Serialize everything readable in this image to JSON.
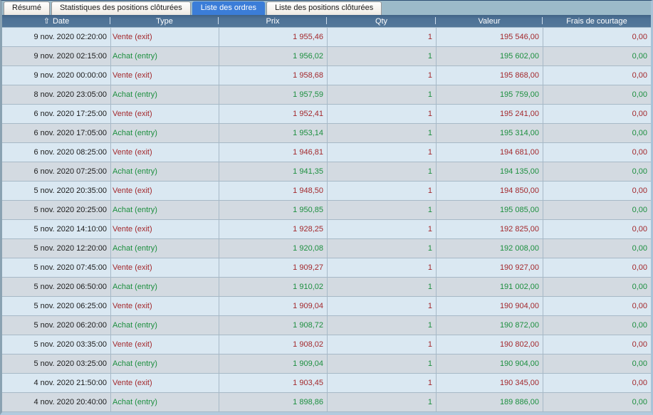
{
  "tabs": [
    {
      "id": "resume",
      "label": "Résumé",
      "active": false
    },
    {
      "id": "stats-positions",
      "label": "Statistiques des positions clôturées",
      "active": false
    },
    {
      "id": "orders-list",
      "label": "Liste des ordres",
      "active": true
    },
    {
      "id": "closed-positions",
      "label": "Liste des positions clôturées",
      "active": false
    }
  ],
  "table": {
    "sort_icon": "⇧",
    "sorted_column": "Date",
    "columns": [
      "Date",
      "Type",
      "Prix",
      "Qty",
      "Valeur",
      "Frais de courtage"
    ],
    "rows": [
      {
        "date": "9 nov. 2020 02:20:00",
        "type": "Vente (exit)",
        "prix": "1 955,46",
        "qty": "1",
        "valeur": "195 546,00",
        "frais": "0,00",
        "side": "sell"
      },
      {
        "date": "9 nov. 2020 02:15:00",
        "type": "Achat (entry)",
        "prix": "1 956,02",
        "qty": "1",
        "valeur": "195 602,00",
        "frais": "0,00",
        "side": "buy"
      },
      {
        "date": "9 nov. 2020 00:00:00",
        "type": "Vente (exit)",
        "prix": "1 958,68",
        "qty": "1",
        "valeur": "195 868,00",
        "frais": "0,00",
        "side": "sell"
      },
      {
        "date": "8 nov. 2020 23:05:00",
        "type": "Achat (entry)",
        "prix": "1 957,59",
        "qty": "1",
        "valeur": "195 759,00",
        "frais": "0,00",
        "side": "buy"
      },
      {
        "date": "6 nov. 2020 17:25:00",
        "type": "Vente (exit)",
        "prix": "1 952,41",
        "qty": "1",
        "valeur": "195 241,00",
        "frais": "0,00",
        "side": "sell"
      },
      {
        "date": "6 nov. 2020 17:05:00",
        "type": "Achat (entry)",
        "prix": "1 953,14",
        "qty": "1",
        "valeur": "195 314,00",
        "frais": "0,00",
        "side": "buy"
      },
      {
        "date": "6 nov. 2020 08:25:00",
        "type": "Vente (exit)",
        "prix": "1 946,81",
        "qty": "1",
        "valeur": "194 681,00",
        "frais": "0,00",
        "side": "sell"
      },
      {
        "date": "6 nov. 2020 07:25:00",
        "type": "Achat (entry)",
        "prix": "1 941,35",
        "qty": "1",
        "valeur": "194 135,00",
        "frais": "0,00",
        "side": "buy"
      },
      {
        "date": "5 nov. 2020 20:35:00",
        "type": "Vente (exit)",
        "prix": "1 948,50",
        "qty": "1",
        "valeur": "194 850,00",
        "frais": "0,00",
        "side": "sell"
      },
      {
        "date": "5 nov. 2020 20:25:00",
        "type": "Achat (entry)",
        "prix": "1 950,85",
        "qty": "1",
        "valeur": "195 085,00",
        "frais": "0,00",
        "side": "buy"
      },
      {
        "date": "5 nov. 2020 14:10:00",
        "type": "Vente (exit)",
        "prix": "1 928,25",
        "qty": "1",
        "valeur": "192 825,00",
        "frais": "0,00",
        "side": "sell"
      },
      {
        "date": "5 nov. 2020 12:20:00",
        "type": "Achat (entry)",
        "prix": "1 920,08",
        "qty": "1",
        "valeur": "192 008,00",
        "frais": "0,00",
        "side": "buy"
      },
      {
        "date": "5 nov. 2020 07:45:00",
        "type": "Vente (exit)",
        "prix": "1 909,27",
        "qty": "1",
        "valeur": "190 927,00",
        "frais": "0,00",
        "side": "sell"
      },
      {
        "date": "5 nov. 2020 06:50:00",
        "type": "Achat (entry)",
        "prix": "1 910,02",
        "qty": "1",
        "valeur": "191 002,00",
        "frais": "0,00",
        "side": "buy"
      },
      {
        "date": "5 nov. 2020 06:25:00",
        "type": "Vente (exit)",
        "prix": "1 909,04",
        "qty": "1",
        "valeur": "190 904,00",
        "frais": "0,00",
        "side": "sell"
      },
      {
        "date": "5 nov. 2020 06:20:00",
        "type": "Achat (entry)",
        "prix": "1 908,72",
        "qty": "1",
        "valeur": "190 872,00",
        "frais": "0,00",
        "side": "buy"
      },
      {
        "date": "5 nov. 2020 03:35:00",
        "type": "Vente (exit)",
        "prix": "1 908,02",
        "qty": "1",
        "valeur": "190 802,00",
        "frais": "0,00",
        "side": "sell"
      },
      {
        "date": "5 nov. 2020 03:25:00",
        "type": "Achat (entry)",
        "prix": "1 909,04",
        "qty": "1",
        "valeur": "190 904,00",
        "frais": "0,00",
        "side": "buy"
      },
      {
        "date": "4 nov. 2020 21:50:00",
        "type": "Vente (exit)",
        "prix": "1 903,45",
        "qty": "1",
        "valeur": "190 345,00",
        "frais": "0,00",
        "side": "sell"
      },
      {
        "date": "4 nov. 2020 20:40:00",
        "type": "Achat (entry)",
        "prix": "1 898,86",
        "qty": "1",
        "valeur": "189 886,00",
        "frais": "0,00",
        "side": "buy"
      }
    ]
  },
  "colors": {
    "buy_green": "#1d8f3f",
    "sell_red": "#a3282c",
    "active_tab_blue": "#3b7dd8",
    "header_steel_blue": "#4e7296",
    "row_light": "#dae8f2",
    "row_dark": "#d3dae1"
  }
}
